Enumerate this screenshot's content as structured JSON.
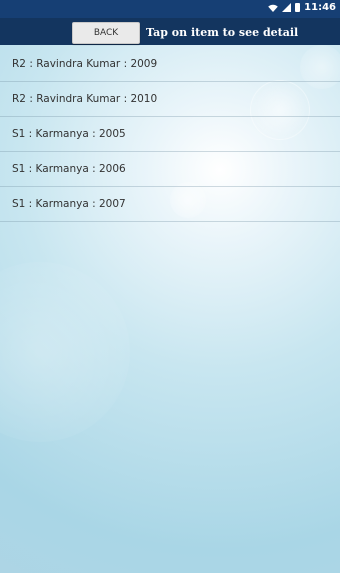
{
  "status_bar": {
    "time": "11:46"
  },
  "header": {
    "back_label": "BACK",
    "title": "Tap on item to see detail"
  },
  "list": {
    "items": [
      "R2 : Ravindra Kumar : 2009",
      "R2 : Ravindra Kumar : 2010",
      "S1 : Karmanya : 2005",
      "S1 : Karmanya : 2006",
      "S1 : Karmanya : 2007"
    ]
  }
}
